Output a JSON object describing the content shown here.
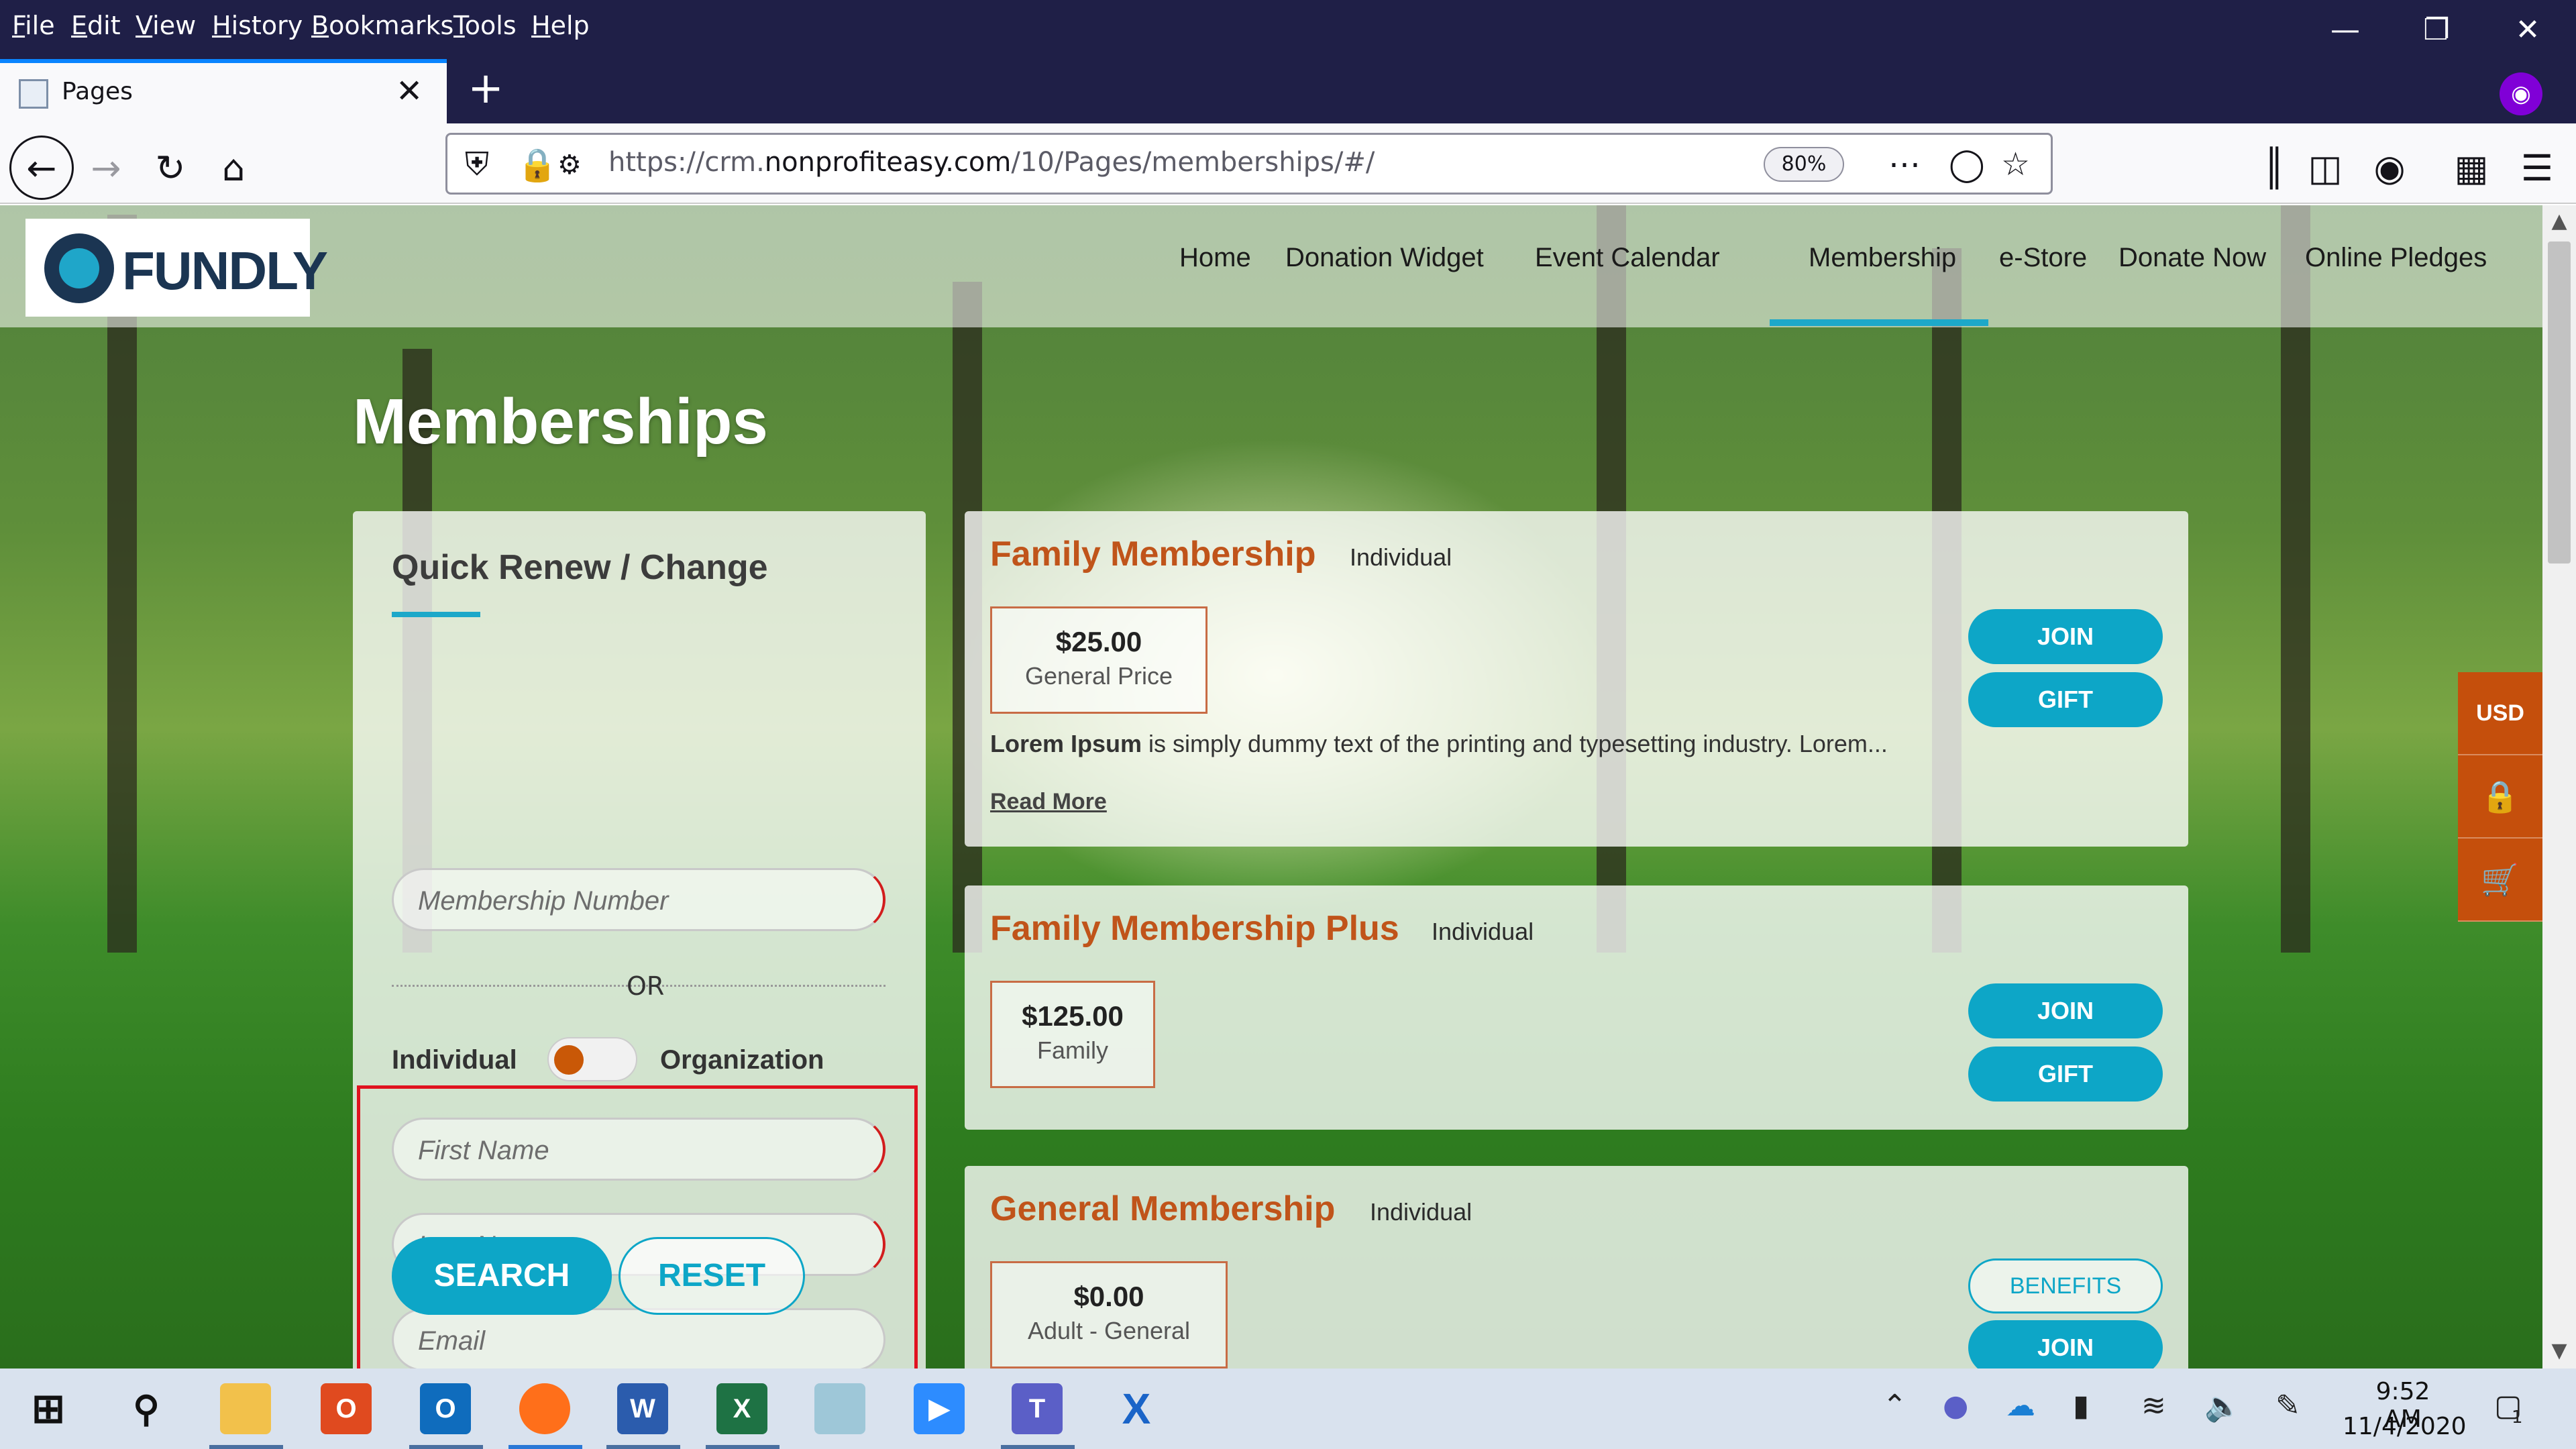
{
  "browser": {
    "menu": [
      "File",
      "Edit",
      "View",
      "History",
      "Bookmarks",
      "Tools",
      "Help"
    ],
    "tab_title": "Pages",
    "url_prefix": "https://crm.",
    "url_domain": "nonprofiteasy.com",
    "url_path": "/10/Pages/memberships/#/",
    "zoom": "80%"
  },
  "site": {
    "logo_text": "FUNDLY",
    "nav": [
      "Home",
      "Donation Widget",
      "Event Calendar",
      "Membership",
      "e-Store",
      "Donate Now",
      "Online Pledges"
    ],
    "active_nav": "Membership",
    "page_title": "Memberships"
  },
  "quick_renew": {
    "title": "Quick Renew / Change",
    "membership_number_placeholder": "Membership Number",
    "or_label": "OR",
    "individual_label": "Individual",
    "organization_label": "Organization",
    "first_name_placeholder": "First Name",
    "last_name_placeholder": "Last Name",
    "email_placeholder": "Email",
    "search_label": "SEARCH",
    "reset_label": "RESET"
  },
  "memberships": [
    {
      "title": "Family Membership",
      "tag": "Individual",
      "price": "$25.00",
      "price_label": "General Price",
      "desc_bold": "Lorem Ipsum",
      "desc_rest": " is simply dummy text of the printing and typesetting industry. Lorem...",
      "read_more": "Read More",
      "join_label": "JOIN",
      "gift_label": "GIFT"
    },
    {
      "title": "Family Membership Plus",
      "tag": "Individual",
      "price": "$125.00",
      "price_label": "Family",
      "join_label": "JOIN",
      "gift_label": "GIFT"
    },
    {
      "title": "General Membership",
      "tag": "Individual",
      "price": "$0.00",
      "price_label": "Adult - General",
      "benefits_label": "BENEFITS",
      "join_label": "JOIN"
    }
  ],
  "side_widgets": {
    "currency": "USD",
    "lock_icon": "lock-icon",
    "cart_icon": "cart-icon"
  },
  "taskbar": {
    "time": "9:52 AM",
    "date": "11/4/2020",
    "notification_count": "1"
  },
  "colors": {
    "accent": "#0da6c7",
    "brand_orange": "#c0541a",
    "highlight_red": "#e0121f"
  }
}
